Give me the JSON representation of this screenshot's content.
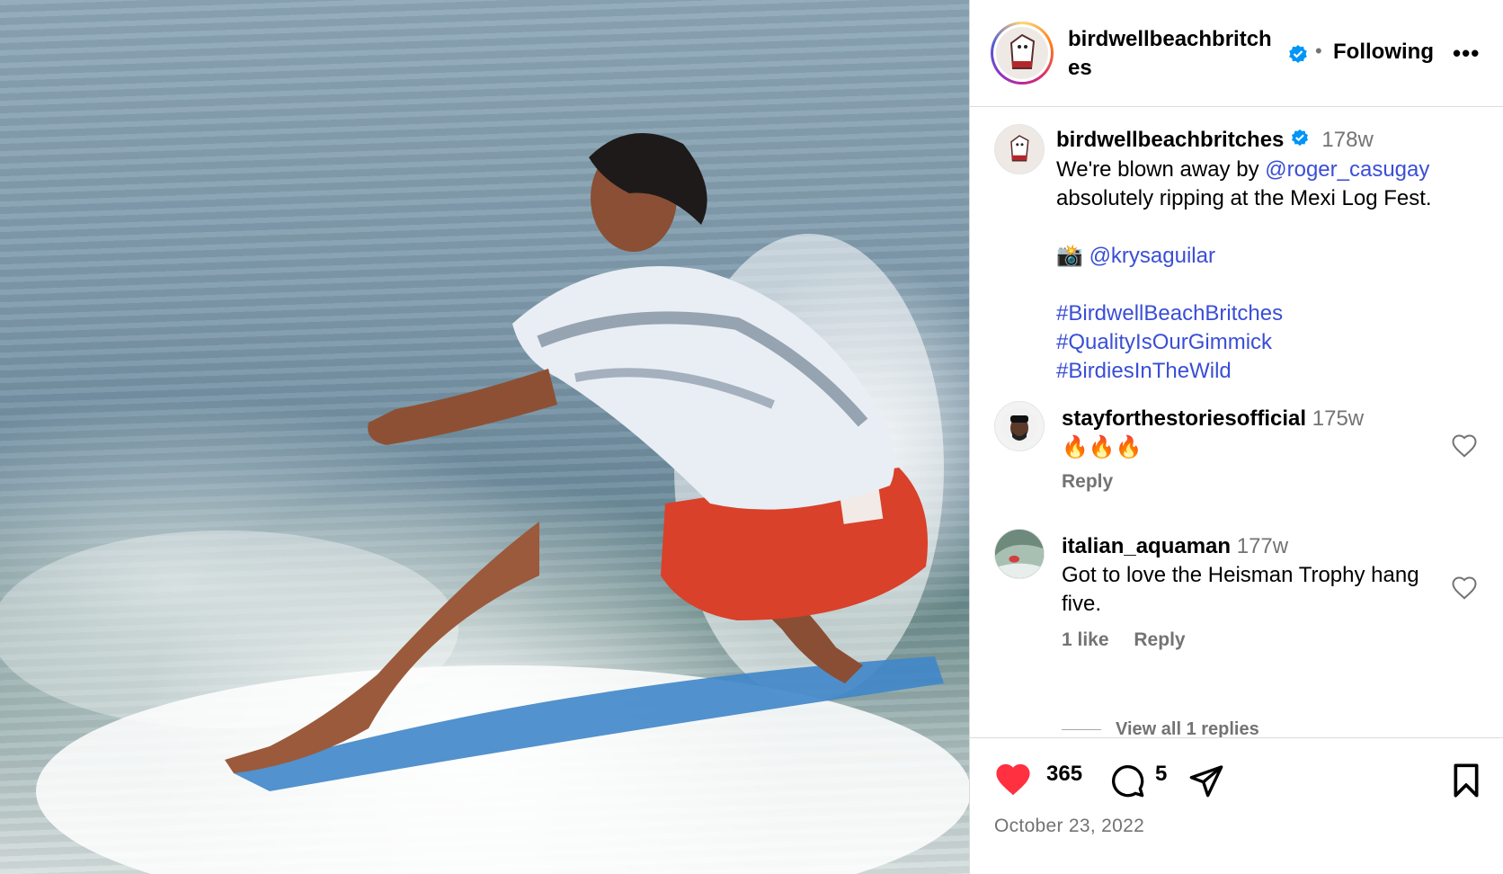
{
  "post": {
    "image_alt": "Surfer in tie-dye shirt and red shorts riding a longboard through spray",
    "author": "birdwellbeachbritches",
    "follow_state": "Following",
    "more_label": "•••",
    "separator": "•"
  },
  "caption": {
    "author": "birdwellbeachbritches",
    "age": "178w",
    "text_before_mention": "We're blown away by ",
    "mention": "@roger_casugay",
    "text_after_mention": "absolutely ripping at the Mexi Log Fest.",
    "camera_emoji": "📸",
    "photo_credit": "@krysaguilar",
    "hashtags": [
      "#BirdwellBeachBritches",
      "#QualityIsOurGimmick",
      "#BirdiesInTheWild"
    ]
  },
  "comments": [
    {
      "user": "stayforthestoriesofficial",
      "age": "175w",
      "text": "🔥🔥🔥",
      "reply_label": "Reply"
    },
    {
      "user": "italian_aquaman",
      "age": "177w",
      "text": "Got to love the Heisman Trophy hang five.",
      "likes_label": "1 like",
      "reply_label": "Reply"
    }
  ],
  "view_replies_label": "View all 1 replies",
  "footer": {
    "likes": "365",
    "comments": "5",
    "date": "October 23, 2022"
  },
  "colors": {
    "like_red": "#ff3040",
    "link_blue": "#3a4ed6",
    "verified_blue": "#0095f6",
    "muted_text": "#737373"
  }
}
